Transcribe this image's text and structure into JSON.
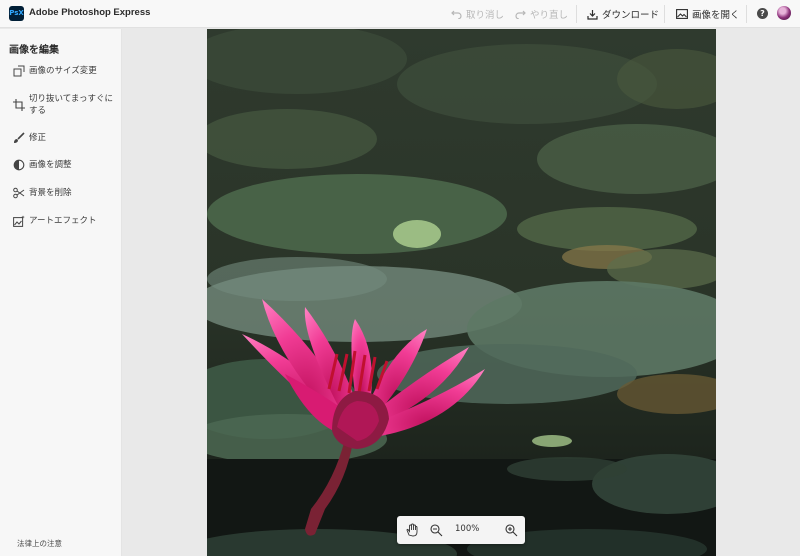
{
  "app": {
    "logo_text": "PsX",
    "title": "Adobe Photoshop Express"
  },
  "toolbar": {
    "undo_label": "取り消し",
    "redo_label": "やり直し",
    "download_label": "ダウンロード",
    "open_label": "画像を開く",
    "help_label": "?"
  },
  "sidebar": {
    "title": "画像を編集",
    "items": [
      {
        "label": "画像のサイズ変更",
        "icon": "resize-icon"
      },
      {
        "label": "切り抜いてまっすぐにする",
        "icon": "crop-icon"
      },
      {
        "label": "修正",
        "icon": "brush-icon"
      },
      {
        "label": "画像を調整",
        "icon": "adjust-icon"
      },
      {
        "label": "背景を削除",
        "icon": "scissors-icon"
      },
      {
        "label": "アートエフェクト",
        "icon": "art-effect-icon"
      }
    ],
    "legal": "法律上の注意"
  },
  "zoom": {
    "level": "100%"
  },
  "colors": {
    "accent": "#31a8ff",
    "logo_bg": "#001e36",
    "disabled_text": "#b7b7b7"
  }
}
